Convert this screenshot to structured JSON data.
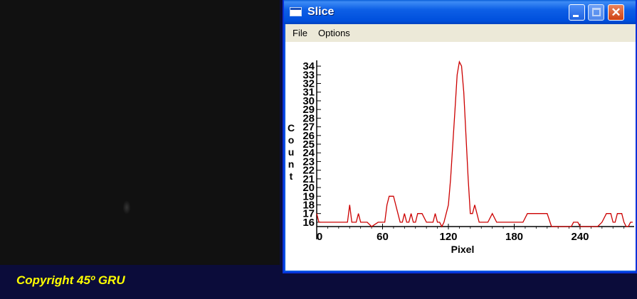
{
  "window": {
    "title": "Slice"
  },
  "menu": {
    "items": [
      "File",
      "Options"
    ]
  },
  "icons": {
    "window": "window-icon",
    "minimize": "minimize-icon",
    "maximize": "maximize-icon",
    "close": "close-icon"
  },
  "footer": {
    "copyright": "Copyright 45º GRU"
  },
  "colors": {
    "line": "#cc0000",
    "footer_bg": "#0b0c3a",
    "copyright_text": "#ffff00"
  },
  "chart_data": {
    "type": "line",
    "xlabel": "Pixel",
    "ylabel": "Count",
    "xlim": [
      0,
      288
    ],
    "ylim": [
      15.5,
      34.5
    ],
    "x_ticks": [
      0,
      60,
      120,
      180,
      240
    ],
    "y_ticks": [
      16,
      17,
      18,
      19,
      20,
      21,
      22,
      23,
      24,
      25,
      26,
      27,
      28,
      29,
      30,
      31,
      32,
      33,
      34
    ],
    "grid": false,
    "series": [
      {
        "x": [
          0,
          2,
          4,
          10,
          20,
          28,
          30,
          32,
          36,
          38,
          40,
          42,
          46,
          50,
          56,
          62,
          64,
          66,
          70,
          72,
          74,
          76,
          78,
          80,
          82,
          84,
          86,
          88,
          90,
          92,
          96,
          100,
          104,
          106,
          108,
          110,
          112,
          114,
          116,
          118,
          120,
          122,
          124,
          126,
          128,
          130,
          132,
          134,
          136,
          138,
          140,
          142,
          144,
          146,
          148,
          150,
          152,
          154,
          156,
          160,
          164,
          168,
          170,
          172,
          174,
          176,
          180,
          184,
          188,
          192,
          198,
          202,
          206,
          210,
          214,
          218,
          222,
          226,
          230,
          232,
          234,
          236,
          238,
          240,
          244,
          248,
          252,
          256,
          260,
          264,
          266,
          268,
          270,
          272,
          274,
          276,
          278,
          280,
          282,
          284,
          286,
          288
        ],
        "y": [
          17,
          16,
          16,
          16,
          16,
          16,
          18,
          16,
          16,
          17,
          16,
          16,
          16,
          15.5,
          16,
          16,
          18,
          19,
          19,
          18,
          17,
          16,
          16,
          17,
          16,
          16,
          17,
          16,
          16,
          17,
          17,
          16,
          16,
          16,
          17,
          16,
          16,
          15.5,
          16,
          17,
          18,
          21,
          25,
          29,
          33,
          34.5,
          34,
          31,
          26,
          21,
          17,
          17,
          18,
          17,
          16,
          16,
          16,
          16,
          16,
          17,
          16,
          16,
          16,
          16,
          16,
          16,
          16,
          16,
          16,
          17,
          17,
          17,
          17,
          17,
          15.5,
          15.5,
          15.5,
          15.5,
          15.5,
          15.5,
          16,
          16,
          16,
          15.5,
          15.5,
          15.5,
          15.5,
          15.5,
          16,
          17,
          17,
          17,
          16,
          16,
          17,
          17,
          17,
          16,
          15.5,
          15.5,
          16,
          16
        ]
      }
    ]
  }
}
